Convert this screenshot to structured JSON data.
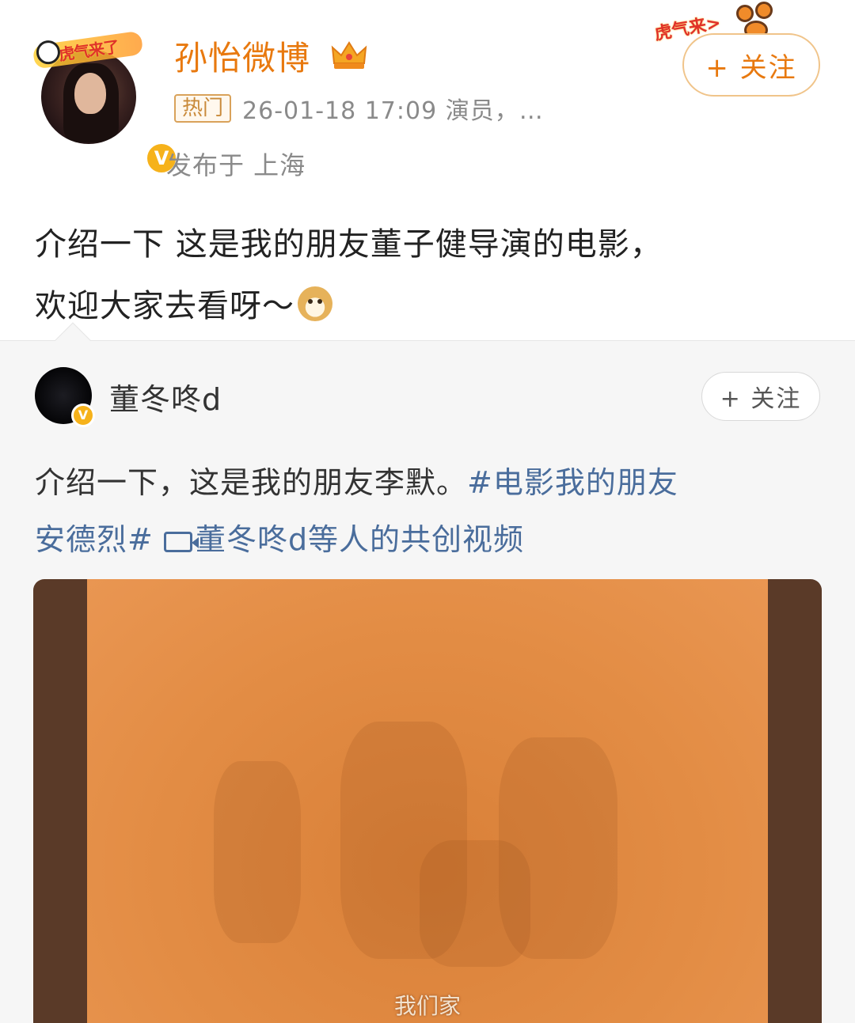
{
  "post": {
    "author": {
      "name": "孙怡微博",
      "frame_text": "虎气来了",
      "verified": "V"
    },
    "hot_badge": "热门",
    "meta": "26-01-18 17:09  演员，…",
    "location": "发布于 上海",
    "follow_label": "+ 关注",
    "decor_text": "虎气来>",
    "text_line1": "介绍一下 这是我的朋友董子健导演的电影，",
    "text_line2": "欢迎大家去看呀～"
  },
  "repost": {
    "author": {
      "name": "董冬咚d",
      "verified": "V"
    },
    "follow_label": "+ 关注",
    "text_plain": "介绍一下，这是我的朋友李默。",
    "hashtag_part1": "#电影我的朋友",
    "hashtag_part2": "安德烈#",
    "cocreate_link": "董冬咚d等人的共创视频",
    "video": {
      "caption": "我们家"
    }
  },
  "colors": {
    "username_orange": "#e8790f",
    "link_blue": "#4a6d9c",
    "verified_gold": "#f6b21b",
    "video_orange": "#e08a40"
  },
  "icons": [
    "crown-icon",
    "doge-emoji-icon",
    "video-camera-icon",
    "verified-v-icon"
  ]
}
